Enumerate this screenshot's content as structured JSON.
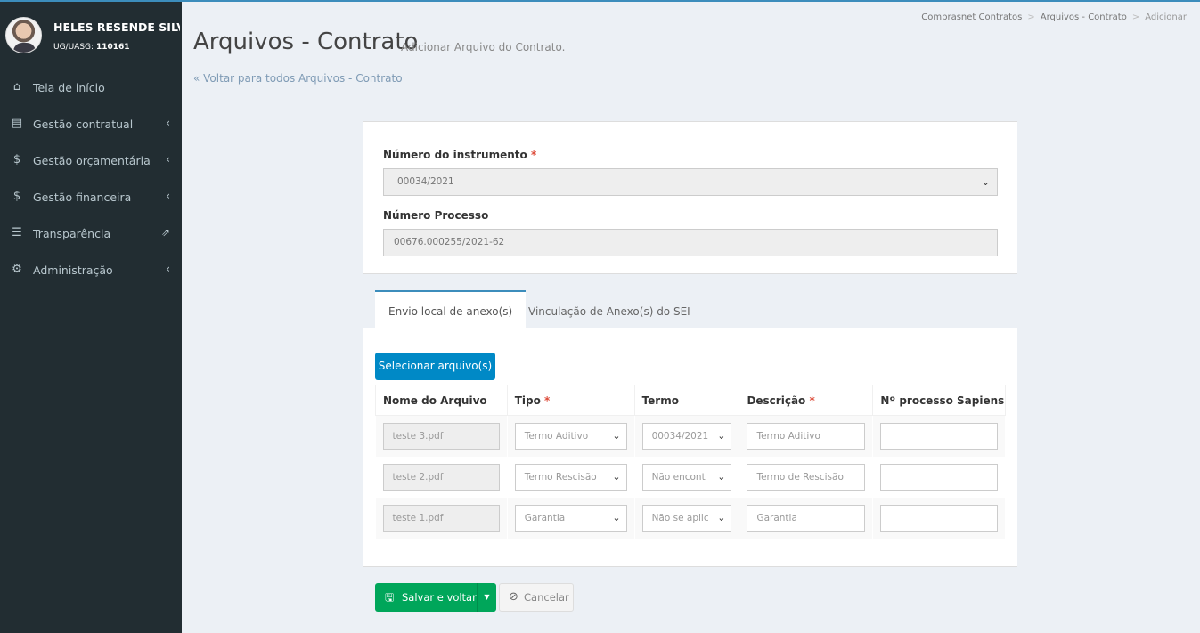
{
  "user": {
    "name": "HELES RESENDE SILVA...",
    "uasg_label": "UG/UASG:",
    "uasg_value": "110161"
  },
  "sidebar": {
    "items": [
      {
        "label": "Tela de início",
        "icon": "home-icon",
        "glyph": "⌂"
      },
      {
        "label": "Gestão contratual",
        "icon": "file-icon",
        "glyph": "▤",
        "arrow": "‹"
      },
      {
        "label": "Gestão orçamentária",
        "icon": "dollar-icon",
        "glyph": "$",
        "arrow": "‹"
      },
      {
        "label": "Gestão financeira",
        "icon": "dollar-icon",
        "glyph": "$",
        "arrow": "‹"
      },
      {
        "label": "Transparência",
        "icon": "list-icon",
        "glyph": "☰",
        "arrow": "⇗"
      },
      {
        "label": "Administração",
        "icon": "gears-icon",
        "glyph": "⚙",
        "arrow": "‹"
      }
    ]
  },
  "breadcrumb": {
    "item1": "Comprasnet Contratos",
    "item2": "Arquivos - Contrato",
    "item3": "Adicionar",
    "separator": ">"
  },
  "header": {
    "title": "Arquivos - Contrato",
    "subtitle": "Adicionar Arquivo do Contrato.",
    "back_link": "« Voltar para todos Arquivos - Contrato"
  },
  "form": {
    "instrumento_label": "Número do instrumento",
    "instrumento_value": "00034/2021",
    "processo_label": "Número Processo",
    "processo_value": "00676.000255/2021-62",
    "required_mark": "*"
  },
  "tabs": [
    {
      "label": "Envio local de anexo(s)",
      "active": true
    },
    {
      "label": "Vinculação de Anexo(s) do SEI",
      "active": false
    }
  ],
  "select_files_label": "Selecionar arquivo(s)",
  "table": {
    "headers": {
      "nome": "Nome do Arquivo",
      "tipo": "Tipo",
      "termo": "Termo",
      "descricao": "Descrição",
      "sapiens": "Nº processo Sapiens"
    },
    "rows": [
      {
        "nome": "teste 3.pdf",
        "tipo": "Termo Aditivo",
        "termo": "00034/2021",
        "descricao": "Termo Aditivo",
        "sapiens": ""
      },
      {
        "nome": "teste 2.pdf",
        "tipo": "Termo Rescisão",
        "termo": "Não encont",
        "descricao": "Termo de Rescisão",
        "sapiens": ""
      },
      {
        "nome": "teste 1.pdf",
        "tipo": "Garantia",
        "termo": "Não se aplic",
        "descricao": "Garantia",
        "sapiens": ""
      }
    ]
  },
  "actions": {
    "save_label": "Salvar e voltar",
    "cancel_label": "Cancelar"
  },
  "colors": {
    "sidebar_bg": "#222d32",
    "accent": "#3c8dbc",
    "select_button": "#0089c6",
    "save_button": "#00a65a",
    "required": "#dd4b39"
  }
}
